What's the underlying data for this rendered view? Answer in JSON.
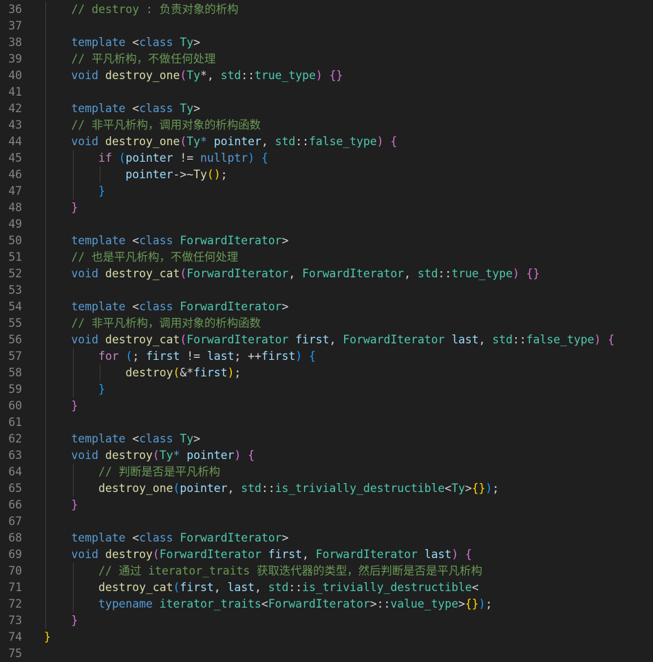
{
  "editor": {
    "theme_colors": {
      "background": "#1f1f1f",
      "line_number": "#858585",
      "keyword": "#569cd6",
      "control": "#c586c0",
      "function": "#dcdcaa",
      "type": "#4ec9b0",
      "variable": "#9cdcfe",
      "comment": "#6a9955",
      "text": "#d4d4d4",
      "bracket_level1": "#ffd700",
      "bracket_level2": "#da70d6",
      "bracket_level3": "#179fff"
    },
    "lines": [
      {
        "n": "36",
        "guides": 1,
        "tokens": [
          [
            "    ",
            "op"
          ],
          [
            "// destroy : 负责对象的析构",
            "cm"
          ]
        ]
      },
      {
        "n": "37",
        "guides": 1,
        "tokens": []
      },
      {
        "n": "38",
        "guides": 1,
        "tokens": [
          [
            "    ",
            "op"
          ],
          [
            "template",
            "kw"
          ],
          [
            " <",
            "op"
          ],
          [
            "class",
            "kw"
          ],
          [
            " ",
            "op"
          ],
          [
            "Ty",
            "ty"
          ],
          [
            ">",
            "op"
          ]
        ]
      },
      {
        "n": "39",
        "guides": 1,
        "tokens": [
          [
            "    ",
            "op"
          ],
          [
            "// 平凡析构，不做任何处理",
            "cm"
          ]
        ]
      },
      {
        "n": "40",
        "guides": 1,
        "tokens": [
          [
            "    ",
            "op"
          ],
          [
            "void",
            "kw"
          ],
          [
            " ",
            "op"
          ],
          [
            "destroy_one",
            "fn"
          ],
          [
            "(",
            "b2"
          ],
          [
            "Ty",
            "ty"
          ],
          [
            "*",
            ""
          ],
          [
            ", ",
            "op"
          ],
          [
            "std",
            "ty"
          ],
          [
            "::",
            "op"
          ],
          [
            "true_type",
            "ty"
          ],
          [
            ")",
            "b2"
          ],
          [
            " ",
            "op"
          ],
          [
            "{}",
            "b2"
          ]
        ]
      },
      {
        "n": "41",
        "guides": 1,
        "tokens": []
      },
      {
        "n": "42",
        "guides": 1,
        "tokens": [
          [
            "    ",
            "op"
          ],
          [
            "template",
            "kw"
          ],
          [
            " <",
            "op"
          ],
          [
            "class",
            "kw"
          ],
          [
            " ",
            "op"
          ],
          [
            "Ty",
            "ty"
          ],
          [
            ">",
            "op"
          ]
        ]
      },
      {
        "n": "43",
        "guides": 1,
        "tokens": [
          [
            "    ",
            "op"
          ],
          [
            "// 非平凡析构，调用对象的析构函数",
            "cm"
          ]
        ]
      },
      {
        "n": "44",
        "guides": 1,
        "tokens": [
          [
            "    ",
            "op"
          ],
          [
            "void",
            "kw"
          ],
          [
            " ",
            "op"
          ],
          [
            "destroy_one",
            "fn"
          ],
          [
            "(",
            "b2"
          ],
          [
            "Ty",
            "ty"
          ],
          [
            "*",
            "kw"
          ],
          [
            " ",
            "op"
          ],
          [
            "pointer",
            "var"
          ],
          [
            ", ",
            "op"
          ],
          [
            "std",
            "ty"
          ],
          [
            "::",
            "op"
          ],
          [
            "false_type",
            "ty"
          ],
          [
            ")",
            "b2"
          ],
          [
            " ",
            "op"
          ],
          [
            "{",
            "b2"
          ]
        ]
      },
      {
        "n": "45",
        "guides": 2,
        "tokens": [
          [
            "        ",
            "op"
          ],
          [
            "if",
            "ctl"
          ],
          [
            " ",
            "op"
          ],
          [
            "(",
            "b3"
          ],
          [
            "pointer",
            "var"
          ],
          [
            " != ",
            "op"
          ],
          [
            "nullptr",
            "kw"
          ],
          [
            ")",
            "b3"
          ],
          [
            " ",
            "op"
          ],
          [
            "{",
            "b3"
          ]
        ]
      },
      {
        "n": "46",
        "guides": 3,
        "tokens": [
          [
            "            ",
            "op"
          ],
          [
            "pointer",
            "var"
          ],
          [
            "->~",
            "op"
          ],
          [
            "Ty",
            "fn"
          ],
          [
            "()",
            "b1"
          ],
          [
            ";",
            "op"
          ]
        ]
      },
      {
        "n": "47",
        "guides": 2,
        "tokens": [
          [
            "        ",
            "op"
          ],
          [
            "}",
            "b3"
          ]
        ]
      },
      {
        "n": "48",
        "guides": 1,
        "tokens": [
          [
            "    ",
            "op"
          ],
          [
            "}",
            "b2"
          ]
        ]
      },
      {
        "n": "49",
        "guides": 1,
        "tokens": []
      },
      {
        "n": "50",
        "guides": 1,
        "tokens": [
          [
            "    ",
            "op"
          ],
          [
            "template",
            "kw"
          ],
          [
            " <",
            "op"
          ],
          [
            "class",
            "kw"
          ],
          [
            " ",
            "op"
          ],
          [
            "ForwardIterator",
            "ty"
          ],
          [
            ">",
            "op"
          ]
        ]
      },
      {
        "n": "51",
        "guides": 1,
        "tokens": [
          [
            "    ",
            "op"
          ],
          [
            "// 也是平凡析构，不做任何处理",
            "cm"
          ]
        ]
      },
      {
        "n": "52",
        "guides": 1,
        "tokens": [
          [
            "    ",
            "op"
          ],
          [
            "void",
            "kw"
          ],
          [
            " ",
            "op"
          ],
          [
            "destroy_cat",
            "fn"
          ],
          [
            "(",
            "b2"
          ],
          [
            "ForwardIterator",
            "ty"
          ],
          [
            ", ",
            "op"
          ],
          [
            "ForwardIterator",
            "ty"
          ],
          [
            ", ",
            "op"
          ],
          [
            "std",
            "ty"
          ],
          [
            "::",
            "op"
          ],
          [
            "true_type",
            "ty"
          ],
          [
            ")",
            "b2"
          ],
          [
            " ",
            "op"
          ],
          [
            "{}",
            "b2"
          ]
        ]
      },
      {
        "n": "53",
        "guides": 1,
        "tokens": []
      },
      {
        "n": "54",
        "guides": 1,
        "tokens": [
          [
            "    ",
            "op"
          ],
          [
            "template",
            "kw"
          ],
          [
            " <",
            "op"
          ],
          [
            "class",
            "kw"
          ],
          [
            " ",
            "op"
          ],
          [
            "ForwardIterator",
            "ty"
          ],
          [
            ">",
            "op"
          ]
        ]
      },
      {
        "n": "55",
        "guides": 1,
        "tokens": [
          [
            "    ",
            "op"
          ],
          [
            "// 非平凡析构，调用对象的析构函数",
            "cm"
          ]
        ]
      },
      {
        "n": "56",
        "guides": 1,
        "tokens": [
          [
            "    ",
            "op"
          ],
          [
            "void",
            "kw"
          ],
          [
            " ",
            "op"
          ],
          [
            "destroy_cat",
            "fn"
          ],
          [
            "(",
            "b2"
          ],
          [
            "ForwardIterator",
            "ty"
          ],
          [
            " ",
            "op"
          ],
          [
            "first",
            "var"
          ],
          [
            ", ",
            "op"
          ],
          [
            "ForwardIterator",
            "ty"
          ],
          [
            " ",
            "op"
          ],
          [
            "last",
            "var"
          ],
          [
            ", ",
            "op"
          ],
          [
            "std",
            "ty"
          ],
          [
            "::",
            "op"
          ],
          [
            "false_type",
            "ty"
          ],
          [
            ")",
            "b2"
          ],
          [
            " ",
            "op"
          ],
          [
            "{",
            "b2"
          ]
        ]
      },
      {
        "n": "57",
        "guides": 2,
        "tokens": [
          [
            "        ",
            "op"
          ],
          [
            "for",
            "ctl"
          ],
          [
            " ",
            "op"
          ],
          [
            "(",
            "b3"
          ],
          [
            "; ",
            "op"
          ],
          [
            "first",
            "var"
          ],
          [
            " != ",
            "op"
          ],
          [
            "last",
            "var"
          ],
          [
            "; ++",
            "op"
          ],
          [
            "first",
            "var"
          ],
          [
            ")",
            "b3"
          ],
          [
            " ",
            "op"
          ],
          [
            "{",
            "b3"
          ]
        ]
      },
      {
        "n": "58",
        "guides": 3,
        "tokens": [
          [
            "            ",
            "op"
          ],
          [
            "destroy",
            "fn"
          ],
          [
            "(",
            "b1"
          ],
          [
            "&*",
            "op"
          ],
          [
            "first",
            "var"
          ],
          [
            ")",
            "b1"
          ],
          [
            ";",
            "op"
          ]
        ]
      },
      {
        "n": "59",
        "guides": 2,
        "tokens": [
          [
            "        ",
            "op"
          ],
          [
            "}",
            "b3"
          ]
        ]
      },
      {
        "n": "60",
        "guides": 1,
        "tokens": [
          [
            "    ",
            "op"
          ],
          [
            "}",
            "b2"
          ]
        ]
      },
      {
        "n": "61",
        "guides": 1,
        "tokens": []
      },
      {
        "n": "62",
        "guides": 1,
        "tokens": [
          [
            "    ",
            "op"
          ],
          [
            "template",
            "kw"
          ],
          [
            " <",
            "op"
          ],
          [
            "class",
            "kw"
          ],
          [
            " ",
            "op"
          ],
          [
            "Ty",
            "ty"
          ],
          [
            ">",
            "op"
          ]
        ]
      },
      {
        "n": "63",
        "guides": 1,
        "tokens": [
          [
            "    ",
            "op"
          ],
          [
            "void",
            "kw"
          ],
          [
            " ",
            "op"
          ],
          [
            "destroy",
            "fn"
          ],
          [
            "(",
            "b2"
          ],
          [
            "Ty",
            "ty"
          ],
          [
            "*",
            "kw"
          ],
          [
            " ",
            "op"
          ],
          [
            "pointer",
            "var"
          ],
          [
            ")",
            "b2"
          ],
          [
            " ",
            "op"
          ],
          [
            "{",
            "b2"
          ]
        ]
      },
      {
        "n": "64",
        "guides": 2,
        "tokens": [
          [
            "        ",
            "op"
          ],
          [
            "// 判断是否是平凡析构",
            "cm"
          ]
        ]
      },
      {
        "n": "65",
        "guides": 2,
        "tokens": [
          [
            "        ",
            "op"
          ],
          [
            "destroy_one",
            "fn"
          ],
          [
            "(",
            "b3"
          ],
          [
            "pointer",
            "var"
          ],
          [
            ", ",
            "op"
          ],
          [
            "std",
            "ty"
          ],
          [
            "::",
            "op"
          ],
          [
            "is_trivially_destructible",
            "ty"
          ],
          [
            "<",
            "op"
          ],
          [
            "Ty",
            "ty"
          ],
          [
            ">",
            "op"
          ],
          [
            "{}",
            "b1"
          ],
          [
            ")",
            "b3"
          ],
          [
            ";",
            "op"
          ]
        ]
      },
      {
        "n": "66",
        "guides": 1,
        "tokens": [
          [
            "    ",
            "op"
          ],
          [
            "}",
            "b2"
          ]
        ]
      },
      {
        "n": "67",
        "guides": 1,
        "tokens": []
      },
      {
        "n": "68",
        "guides": 1,
        "tokens": [
          [
            "    ",
            "op"
          ],
          [
            "template",
            "kw"
          ],
          [
            " <",
            "op"
          ],
          [
            "class",
            "kw"
          ],
          [
            " ",
            "op"
          ],
          [
            "ForwardIterator",
            "ty"
          ],
          [
            ">",
            "op"
          ]
        ]
      },
      {
        "n": "69",
        "guides": 1,
        "tokens": [
          [
            "    ",
            "op"
          ],
          [
            "void",
            "kw"
          ],
          [
            " ",
            "op"
          ],
          [
            "destroy",
            "fn"
          ],
          [
            "(",
            "b2"
          ],
          [
            "ForwardIterator",
            "ty"
          ],
          [
            " ",
            "op"
          ],
          [
            "first",
            "var"
          ],
          [
            ", ",
            "op"
          ],
          [
            "ForwardIterator",
            "ty"
          ],
          [
            " ",
            "op"
          ],
          [
            "last",
            "var"
          ],
          [
            ")",
            "b2"
          ],
          [
            " ",
            "op"
          ],
          [
            "{",
            "b2"
          ]
        ]
      },
      {
        "n": "70",
        "guides": 2,
        "tokens": [
          [
            "        ",
            "op"
          ],
          [
            "// 通过 iterator_traits 获取迭代器的类型，然后判断是否是平凡析构",
            "cm"
          ]
        ]
      },
      {
        "n": "71",
        "guides": 2,
        "tokens": [
          [
            "        ",
            "op"
          ],
          [
            "destroy_cat",
            "fn"
          ],
          [
            "(",
            "b3"
          ],
          [
            "first",
            "var"
          ],
          [
            ", ",
            "op"
          ],
          [
            "last",
            "var"
          ],
          [
            ", ",
            "op"
          ],
          [
            "std",
            "ty"
          ],
          [
            "::",
            "op"
          ],
          [
            "is_trivially_destructible",
            "ty"
          ],
          [
            "<",
            "op"
          ]
        ]
      },
      {
        "n": "72",
        "guides": 2,
        "tokens": [
          [
            "        ",
            "op"
          ],
          [
            "typename",
            "kw"
          ],
          [
            " ",
            "op"
          ],
          [
            "iterator_traits",
            "ty"
          ],
          [
            "<",
            "op"
          ],
          [
            "ForwardIterator",
            "ty"
          ],
          [
            ">::",
            "op"
          ],
          [
            "value_type",
            "ty"
          ],
          [
            ">",
            "op"
          ],
          [
            "{}",
            "b1"
          ],
          [
            ")",
            "b3"
          ],
          [
            ";",
            "op"
          ]
        ]
      },
      {
        "n": "73",
        "guides": 1,
        "tokens": [
          [
            "    ",
            "op"
          ],
          [
            "}",
            "b2"
          ]
        ]
      },
      {
        "n": "74",
        "guides": 0,
        "tokens": [
          [
            "}",
            "b1"
          ]
        ]
      },
      {
        "n": "75",
        "guides": 0,
        "tokens": []
      }
    ]
  }
}
